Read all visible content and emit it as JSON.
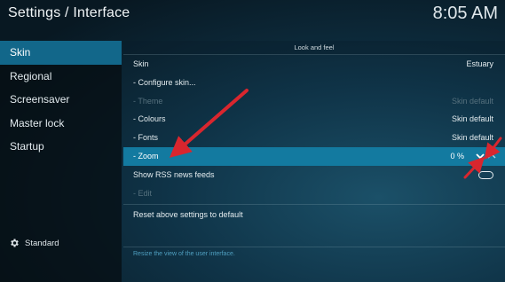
{
  "header": {
    "title": "Settings / Interface",
    "clock": "8:05 AM"
  },
  "sidebar": {
    "items": [
      {
        "label": "Skin"
      },
      {
        "label": "Regional"
      },
      {
        "label": "Screensaver"
      },
      {
        "label": "Master lock"
      },
      {
        "label": "Startup"
      }
    ],
    "footer_label": "Standard",
    "footer_icon": "gear-icon"
  },
  "panel": {
    "section_title": "Look and feel",
    "rows": [
      {
        "label": "Skin",
        "value": "Estuary"
      },
      {
        "label": "- Configure skin...",
        "value": ""
      },
      {
        "label": "- Theme",
        "value": "Skin default"
      },
      {
        "label": "- Colours",
        "value": "Skin default"
      },
      {
        "label": "- Fonts",
        "value": "Skin default"
      },
      {
        "label": "- Zoom",
        "value": "0 %"
      },
      {
        "label": "Show RSS news feeds",
        "value": ""
      },
      {
        "label": "- Edit",
        "value": ""
      }
    ],
    "reset_label": "Reset above settings to default",
    "hint": "Resize the view of the user interface."
  },
  "colors": {
    "selected_row": "#137aa0",
    "active_sidebar": "#12678a",
    "annotation_arrow": "#d9262e",
    "hint_text": "#4f9fc0"
  }
}
